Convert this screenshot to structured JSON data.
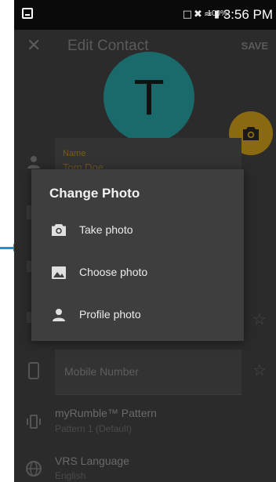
{
  "status_bar": {
    "battery": "100%",
    "time": "3:56 PM"
  },
  "app_bar": {
    "title": "Edit Contact",
    "save_label": "SAVE"
  },
  "contact": {
    "avatar_letter": "T",
    "name_label": "Name",
    "name_value": "Tom Doe"
  },
  "form": {
    "mobile_placeholder": "Mobile Number",
    "pattern_title": "myRumble™ Pattern",
    "pattern_value": "Pattern 1 (Default)",
    "language_title": "VRS Language",
    "language_value": "English"
  },
  "dialog": {
    "title": "Change Photo",
    "items": [
      {
        "label": "Take photo",
        "icon": "camera-icon"
      },
      {
        "label": "Choose photo",
        "icon": "image-icon"
      },
      {
        "label": "Profile photo",
        "icon": "person-icon"
      }
    ]
  },
  "colors": {
    "accent": "#e8a317",
    "avatar": "#2aa3a5",
    "dialog_bg": "#3e3e3e",
    "pointer": "#1e90d6"
  }
}
